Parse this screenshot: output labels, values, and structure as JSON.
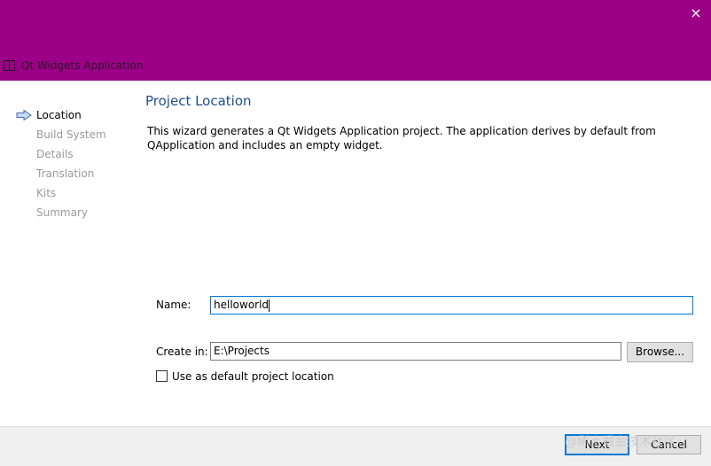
{
  "window": {
    "title": "Qt Widgets Application",
    "close_glyph": "×",
    "accent_color": "#9b0087"
  },
  "steps": [
    {
      "label": "Location",
      "current": true
    },
    {
      "label": "Build System",
      "current": false
    },
    {
      "label": "Details",
      "current": false
    },
    {
      "label": "Translation",
      "current": false
    },
    {
      "label": "Kits",
      "current": false
    },
    {
      "label": "Summary",
      "current": false
    }
  ],
  "page": {
    "title": "Project Location",
    "description": "This wizard generates a Qt Widgets Application project. The application derives by default from QApplication and includes an empty widget."
  },
  "form": {
    "name_label": "Name:",
    "name_value": "helloworld",
    "create_label": "Create in:",
    "create_value": "E:\\Projects",
    "browse_label": "Browse...",
    "default_checkbox_label": "Use as default project location",
    "default_checked": false
  },
  "footer": {
    "next_label": "Next",
    "cancel_label": "Cancel",
    "watermark": "@稀土掘金技术社区"
  }
}
